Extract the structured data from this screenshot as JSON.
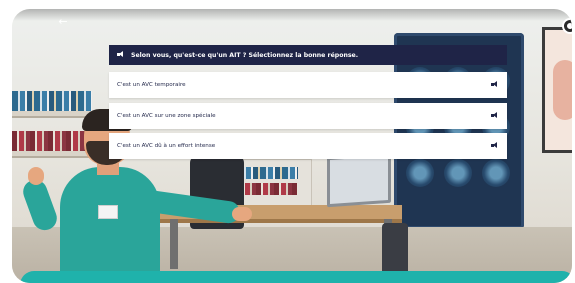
{
  "quiz": {
    "question": "Selon vous, qu'est-ce qu'un AIT ? Sélectionnez la bonne réponse.",
    "answers": [
      {
        "label": "C'est un AVC temporaire"
      },
      {
        "label": "C'est un AVC sur une zone spéciale"
      },
      {
        "label": "C'est un AVC dû à un effort intense"
      }
    ]
  },
  "nav": {
    "back_icon": "arrow-left-icon",
    "settings_icon": "gear-icon"
  },
  "colors": {
    "question_bg": "#1f2447",
    "answer_bg": "#ffffff",
    "accent_teal": "#1fb2ab"
  }
}
